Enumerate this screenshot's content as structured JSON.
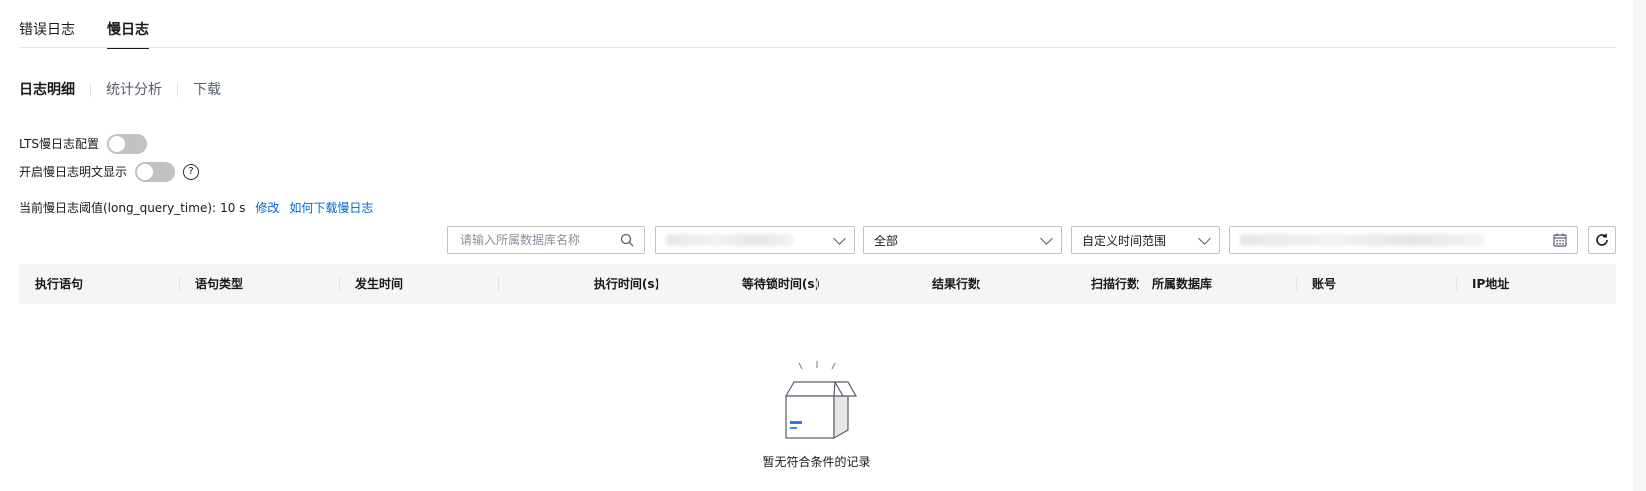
{
  "tabs": [
    {
      "label": "错误日志",
      "active": false
    },
    {
      "label": "慢日志",
      "active": true
    }
  ],
  "subnav": [
    {
      "label": "日志明细",
      "active": true
    },
    {
      "label": "统计分析",
      "active": false
    },
    {
      "label": "下载",
      "active": false
    }
  ],
  "settings": {
    "lts_label": "LTS慢日志配置",
    "lts_enabled": false,
    "plaintext_label": "开启慢日志明文显示",
    "plaintext_enabled": false,
    "threshold_label": "当前慢日志阈值(long_query_time):",
    "threshold_value": "10 s",
    "modify_link": "修改",
    "download_link": "如何下载慢日志"
  },
  "filters": {
    "db_search_placeholder": "请输入所属数据库名称",
    "statement_type_value": "全部",
    "time_range_value": "自定义时间范围"
  },
  "table": {
    "columns": [
      "执行语句",
      "语句类型",
      "发生时间",
      "执行时间(s)",
      "等待锁时间(s)",
      "结果行数",
      "扫描行数",
      "所属数据库",
      "账号",
      "IP地址"
    ]
  },
  "empty_state": {
    "text": "暂无符合条件的记录"
  },
  "colors": {
    "primary_text": "#191919",
    "link": "#0067d1",
    "switch_off": "#c2c2c2",
    "header_bg": "#f5f5f6"
  },
  "icons": [
    "search-icon",
    "chevron-down-icon",
    "calendar-icon",
    "refresh-icon",
    "help-icon",
    "empty-box-icon"
  ]
}
